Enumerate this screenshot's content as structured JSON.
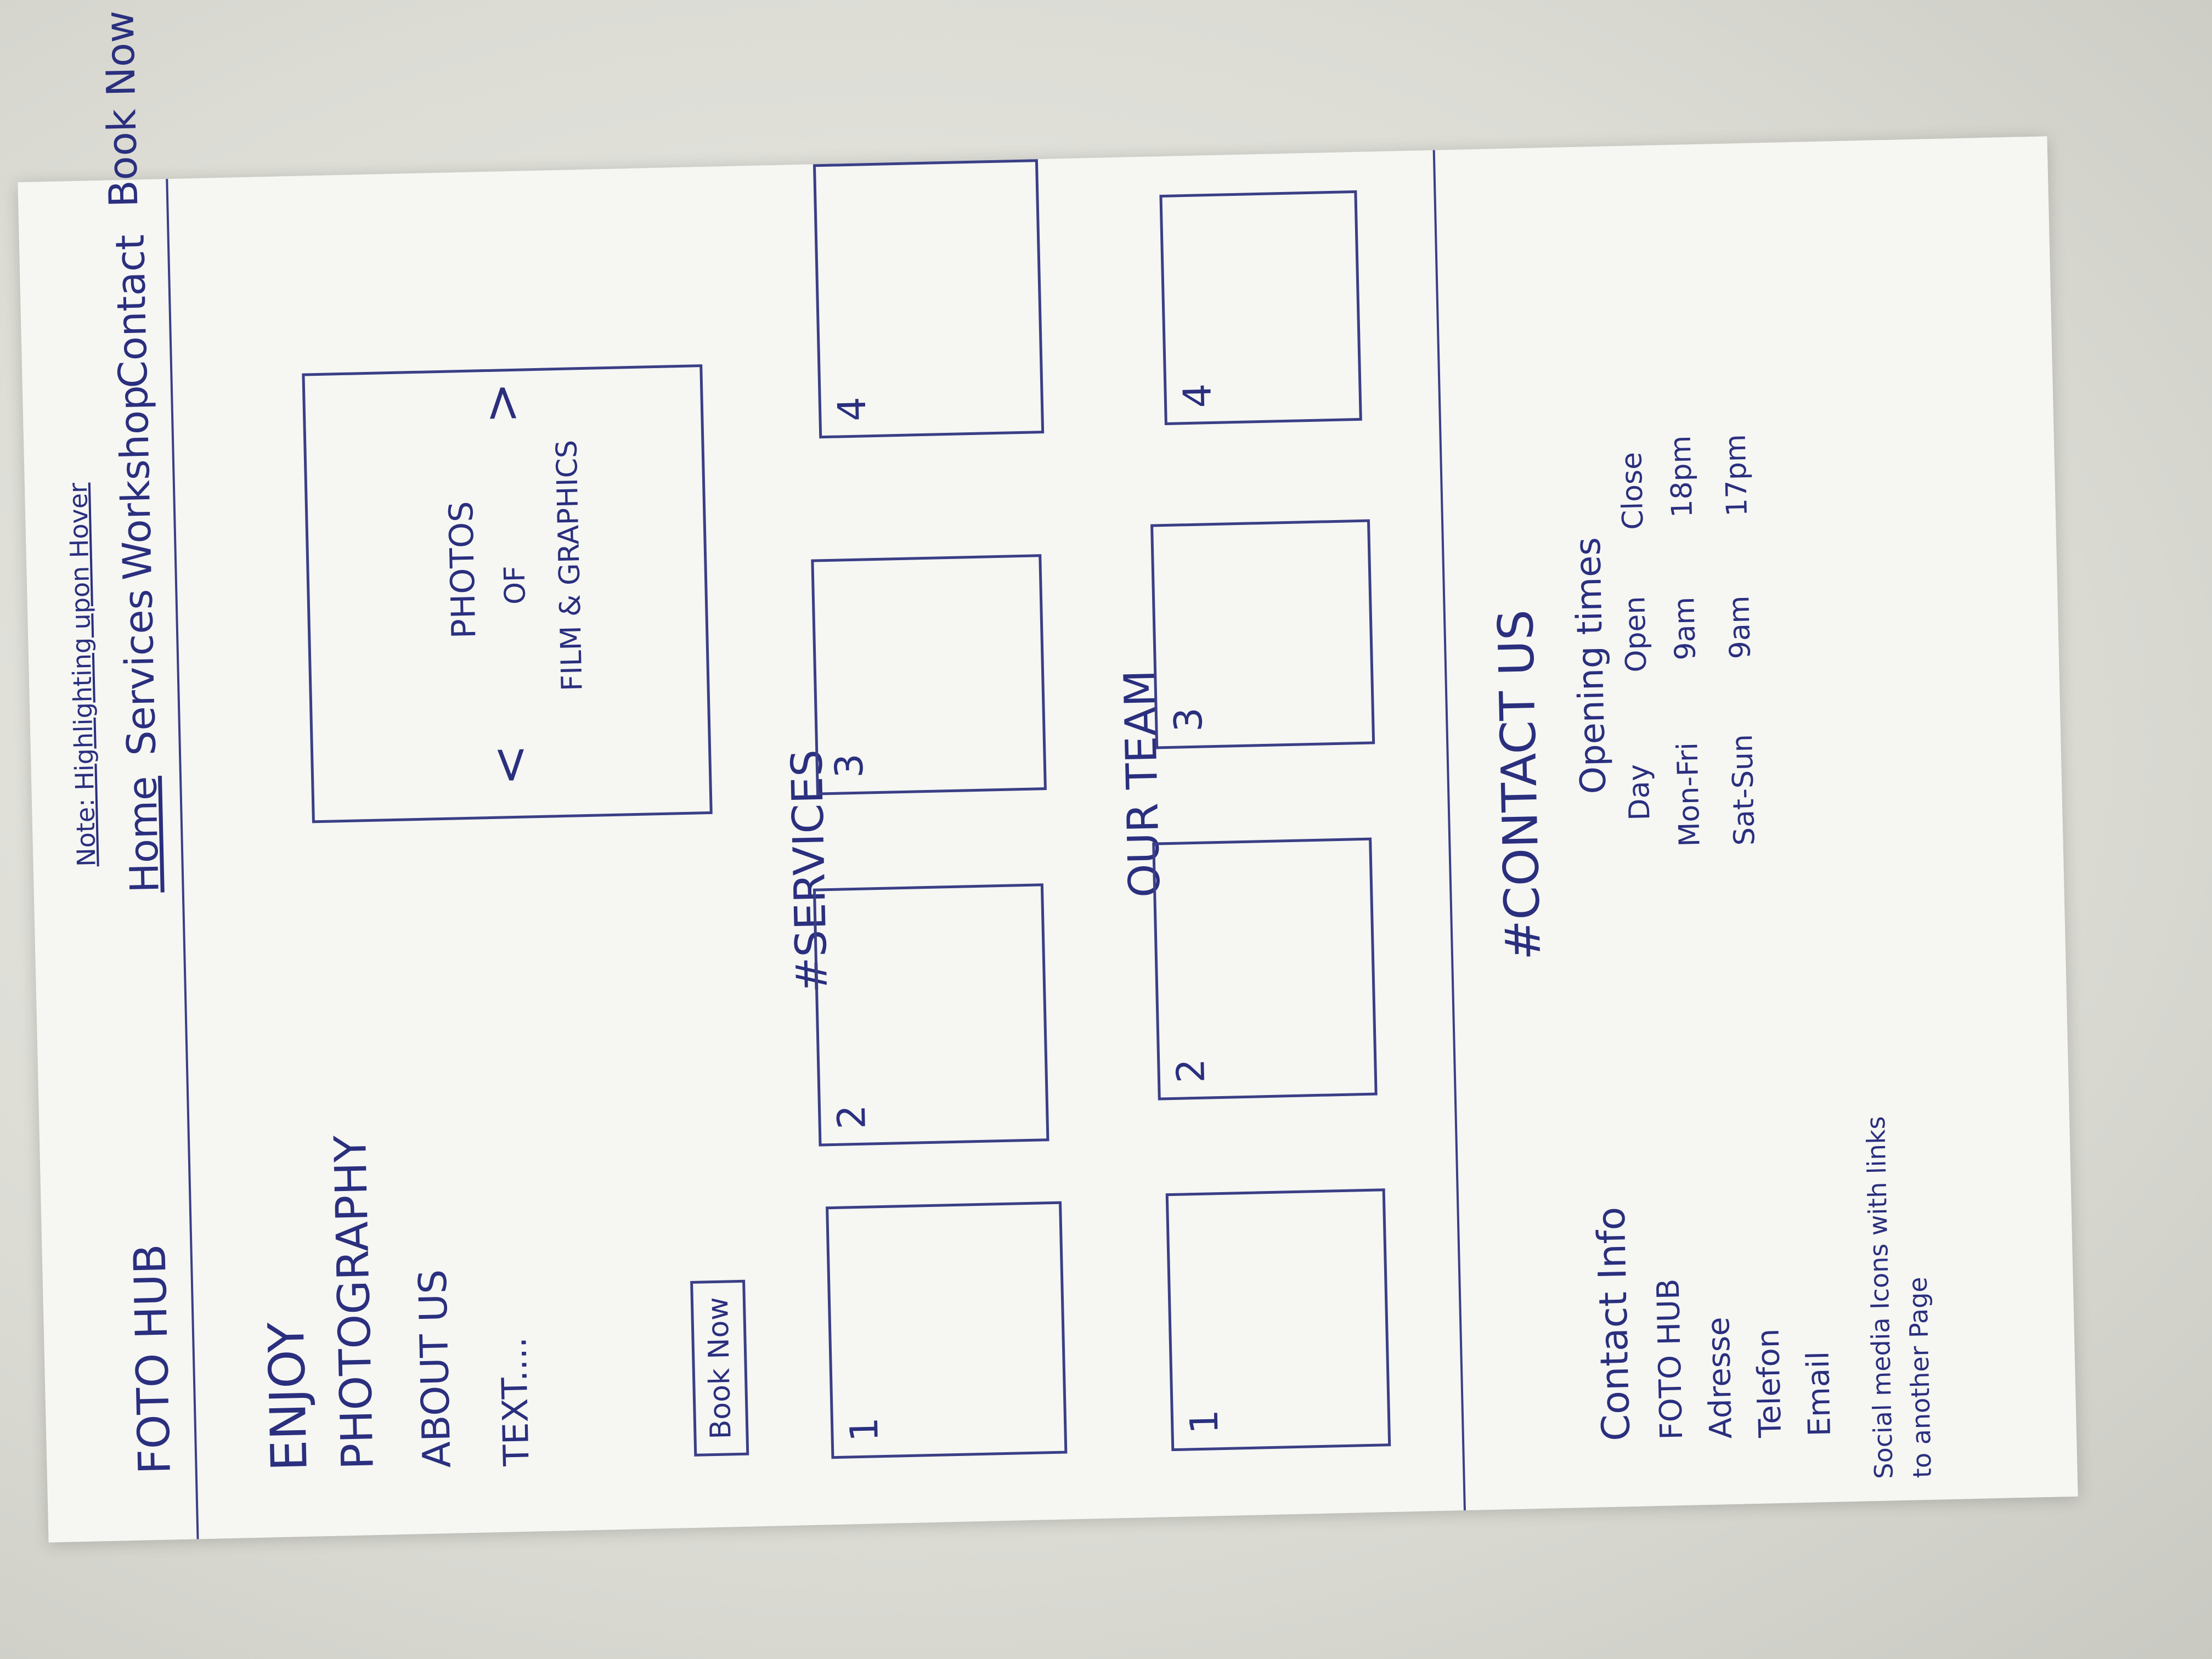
{
  "brand": "FOTO HUB",
  "note": "Note: Highlighting upon Hover",
  "nav": [
    "Home",
    "Services",
    "Workshop",
    "Contact",
    "Book Now"
  ],
  "hero": {
    "heading_line1": "ENJOY",
    "heading_line2": "PHOTOGRAPHY",
    "about": "ABOUT US",
    "text": "TEXT....",
    "button": "Book Now",
    "carousel_line1": "PHOTOS",
    "carousel_line2": "OF",
    "carousel_line3": "FILM & GRAPHICS",
    "prev": "<",
    "next": ">"
  },
  "services": {
    "title": "#SERVICES",
    "cards": [
      "1",
      "2",
      "3",
      "4"
    ]
  },
  "team": {
    "title": "OUR TEAM",
    "cards": [
      "1",
      "2",
      "3",
      "4"
    ]
  },
  "contact": {
    "title": "#CONTACT US",
    "info_title": "Contact Info",
    "info_items": [
      "FOTO HUB",
      "Adresse",
      "Telefon",
      "Email"
    ],
    "social": "Social media Icons with links",
    "social_line2": "to another Page",
    "hours_title": "Opening times",
    "hours_header": [
      "Day",
      "Open",
      "Close"
    ],
    "hours_rows": [
      [
        "Mon-Fri",
        "9am",
        "18pm"
      ],
      [
        "Sat-Sun",
        "9am",
        "17pm"
      ]
    ]
  }
}
